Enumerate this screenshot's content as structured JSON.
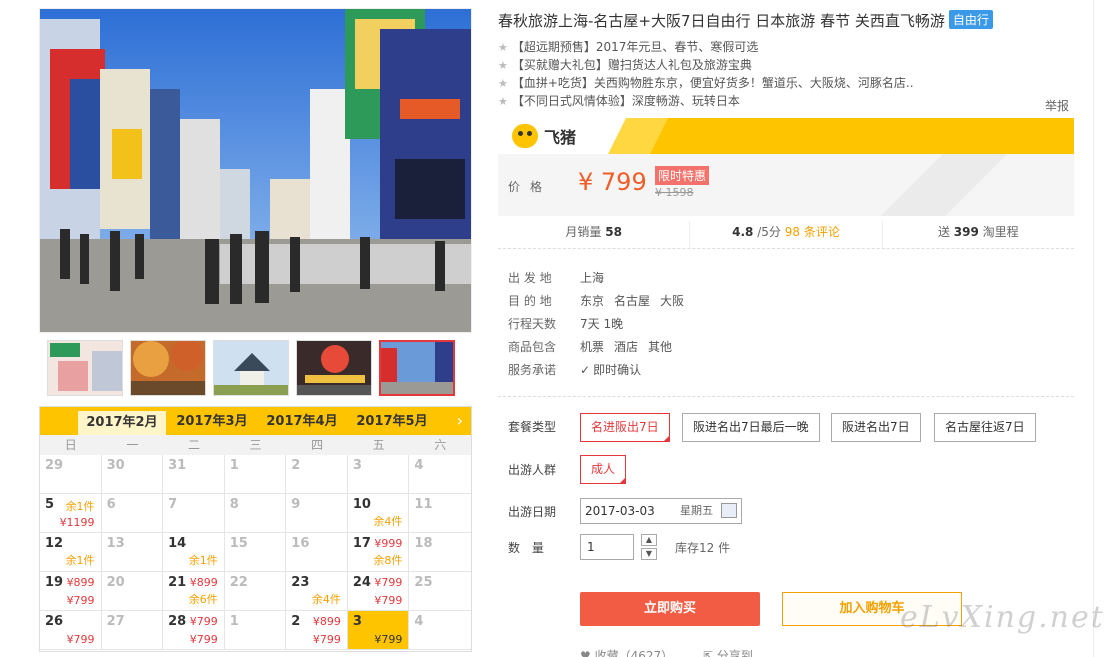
{
  "title": "春秋旅游上海-名古屋+大阪7日自由行 日本旅游 春节 关西直飞畅游",
  "title_badge": "自由行",
  "promos": [
    "【超远期预售】2017年元旦、春节、寒假可选",
    "【买就赠大礼包】赠扫货达人礼包及旅游宝典",
    "【血拼+吃货】关西购物胜东京，便宜好货多！蟹道乐、大阪烧、河豚名店..",
    "【不同日式风情体验】深度畅游、玩转日本"
  ],
  "report": "举报",
  "brand": "飞猪",
  "price": {
    "label": "价格",
    "value": "¥ 799",
    "badge": "限时特惠",
    "original": "¥ 1598"
  },
  "stats": {
    "monthly_label": "月销量",
    "monthly_value": "58",
    "rating_value": "4.8",
    "rating_suffix": "/5分",
    "reviews": "98 条评论",
    "miles_prefix": "送",
    "miles_value": "399",
    "miles_suffix": "淘里程"
  },
  "info": [
    {
      "key": "出 发 地",
      "values": [
        "上海"
      ]
    },
    {
      "key": "目 的 地",
      "values": [
        "东京",
        "名古屋",
        "大阪"
      ]
    },
    {
      "key": "行程天数",
      "values": [
        "7天 1晚"
      ]
    },
    {
      "key": "商品包含",
      "values": [
        "机票",
        "酒店",
        "其他"
      ]
    },
    {
      "key": "服务承诺",
      "values": [
        "即时确认"
      ]
    }
  ],
  "package_label": "套餐类型",
  "packages": [
    "名进阪出7日",
    "阪进名出7日最后一晚",
    "阪进名出7日",
    "名古屋往返7日"
  ],
  "group_label": "出游人群",
  "group_option": "成人",
  "date_label": "出游日期",
  "date_value": "2017-03-03",
  "date_weekday": "星期五",
  "qty_label": "数 量",
  "qty_value": "1",
  "stock": "库存12 件",
  "buy_label": "立即购买",
  "cart_label": "加入购物车",
  "fav_label": "收藏（4627）",
  "share_label": "分享到",
  "watermark": "eLvXing.net",
  "months": [
    "2017年2月",
    "2017年3月",
    "2017年4月",
    "2017年5月"
  ],
  "weekdays": [
    "日",
    "一",
    "二",
    "三",
    "四",
    "五",
    "六"
  ],
  "calendar": [
    {
      "d": "29",
      "off": true
    },
    {
      "d": "30",
      "off": true
    },
    {
      "d": "31",
      "off": true
    },
    {
      "d": "1",
      "off": true
    },
    {
      "d": "2",
      "off": true
    },
    {
      "d": "3",
      "off": true
    },
    {
      "d": "4",
      "off": true
    },
    {
      "d": "5",
      "s": "余1件",
      "p": "¥1199"
    },
    {
      "d": "6",
      "off": true
    },
    {
      "d": "7",
      "off": true
    },
    {
      "d": "8",
      "off": true
    },
    {
      "d": "9",
      "off": true
    },
    {
      "d": "10",
      "p": "余4件",
      "po": true
    },
    {
      "d": "11",
      "off": true
    },
    {
      "d": "12",
      "p": "余1件",
      "po": true
    },
    {
      "d": "13",
      "off": true
    },
    {
      "d": "14",
      "p": "余1件",
      "po": true
    },
    {
      "d": "15",
      "off": true
    },
    {
      "d": "16",
      "off": true
    },
    {
      "d": "17",
      "s": "¥999",
      "sr": true,
      "p": "余8件",
      "po": true
    },
    {
      "d": "18",
      "off": true
    },
    {
      "d": "19",
      "s": "¥899",
      "sr": true,
      "p": "¥799"
    },
    {
      "d": "20",
      "off": true
    },
    {
      "d": "21",
      "s": "¥899",
      "sr": true,
      "p": "余6件",
      "po": true
    },
    {
      "d": "22",
      "off": true
    },
    {
      "d": "23",
      "p": "余4件",
      "po": true
    },
    {
      "d": "24",
      "s": "¥799",
      "sr": true,
      "p": "¥799"
    },
    {
      "d": "25",
      "off": true
    },
    {
      "d": "26",
      "p": "¥799"
    },
    {
      "d": "27",
      "off": true
    },
    {
      "d": "28",
      "s": "¥799",
      "sr": true,
      "p": "¥799"
    },
    {
      "d": "1",
      "off": true
    },
    {
      "d": "2",
      "s": "¥899",
      "sr": true,
      "p": "¥799"
    },
    {
      "d": "3",
      "p": "¥799",
      "hl": true
    },
    {
      "d": "4",
      "off": true
    }
  ],
  "colors": {
    "accent": "#ffc400",
    "price": "#f25c27",
    "buy": "#f25c44",
    "selected": "#e4393c",
    "badge_blue": "#3b9ae8"
  }
}
